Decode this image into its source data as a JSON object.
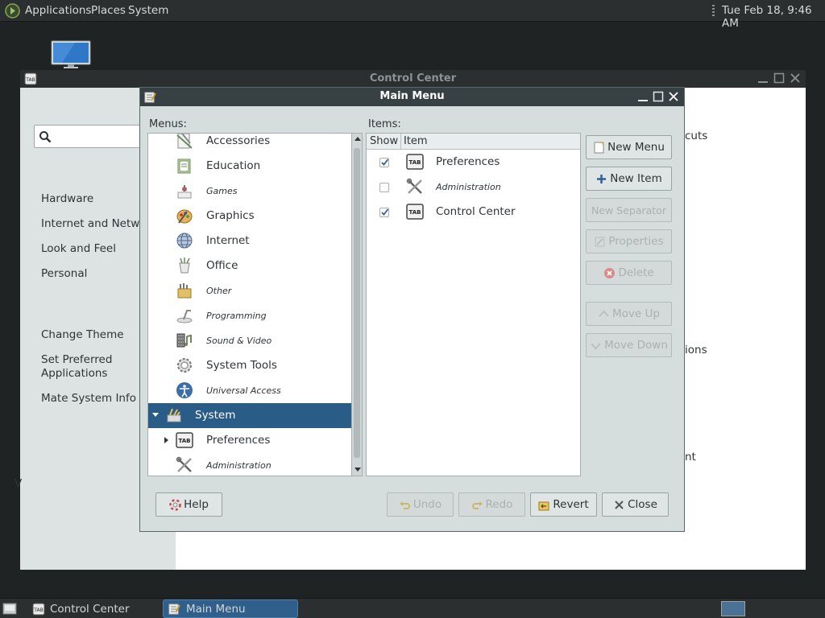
{
  "top_panel": {
    "menus": [
      "Applications",
      "Places",
      "System"
    ],
    "clock": "Tue Feb 18,  9:46 AM"
  },
  "control_center": {
    "title": "Control Center",
    "search_value": "",
    "sidebar_groups": [
      "Hardware",
      "Internet and Networ",
      "Look and Feel",
      "Personal"
    ],
    "sidebar_actions": [
      "Change Theme",
      "Set Preferred",
      "Applications",
      "Mate System Info"
    ],
    "partial_left": "V",
    "content_fragments": [
      "cuts",
      "ions",
      "nt"
    ]
  },
  "main_menu": {
    "title": "Main Menu",
    "menus_label": "Menus:",
    "items_label": "Items:",
    "menus": [
      {
        "label": "Accessories",
        "italic": false,
        "icon": "accessories-icon"
      },
      {
        "label": "Education",
        "italic": false,
        "icon": "education-icon"
      },
      {
        "label": "Games",
        "italic": true,
        "icon": "games-icon"
      },
      {
        "label": "Graphics",
        "italic": false,
        "icon": "graphics-icon"
      },
      {
        "label": "Internet",
        "italic": false,
        "icon": "internet-globe-icon"
      },
      {
        "label": "Office",
        "italic": false,
        "icon": "office-icon"
      },
      {
        "label": "Other",
        "italic": true,
        "icon": "other-icon"
      },
      {
        "label": "Programming",
        "italic": true,
        "icon": "programming-icon"
      },
      {
        "label": "Sound & Video",
        "italic": true,
        "icon": "sound-video-icon"
      },
      {
        "label": "System Tools",
        "italic": false,
        "icon": "system-tools-gear-icon"
      },
      {
        "label": "Universal Access",
        "italic": true,
        "icon": "universal-access-icon"
      },
      {
        "label": "System",
        "italic": false,
        "icon": "system-icon",
        "selected": true,
        "expanded": true
      },
      {
        "label": "Preferences",
        "italic": false,
        "icon": "preferences-icon",
        "child": true,
        "collapsed": true
      },
      {
        "label": "Administration",
        "italic": true,
        "icon": "administration-icon",
        "child": true
      }
    ],
    "items_columns": [
      "Show",
      "Item"
    ],
    "items": [
      {
        "show": true,
        "label": "Preferences",
        "italic": false,
        "icon": "preferences-icon"
      },
      {
        "show": false,
        "label": "Administration",
        "italic": true,
        "icon": "administration-icon"
      },
      {
        "show": true,
        "label": "Control Center",
        "italic": false,
        "icon": "control-center-icon"
      }
    ],
    "side_buttons": {
      "new_menu": "New Menu",
      "new_item": "New Item",
      "new_separator": "New Separator",
      "properties": "Properties",
      "delete": "Delete",
      "move_up": "Move Up",
      "move_down": "Move Down"
    },
    "bottom_buttons": {
      "help": "Help",
      "undo": "Undo",
      "redo": "Redo",
      "revert": "Revert",
      "close": "Close"
    }
  },
  "bottom_panel": {
    "tasks": [
      "Control Center",
      "Main Menu"
    ]
  },
  "colors": {
    "selection": "#2a5c88",
    "panel": "#2b2f30",
    "dialog_bg": "#d6dddd"
  }
}
